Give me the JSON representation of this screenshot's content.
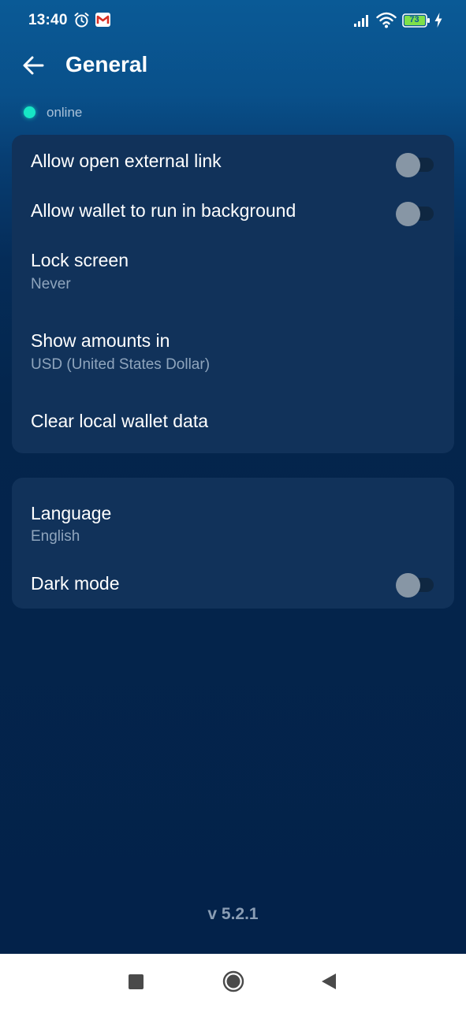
{
  "status_bar": {
    "time": "13:40",
    "battery": "73",
    "icons": [
      "alarm-icon",
      "gmail-icon",
      "signal-icon",
      "wifi-icon",
      "battery-icon",
      "charging-icon"
    ]
  },
  "header": {
    "title": "General",
    "back_icon": "arrow-left-icon"
  },
  "connection": {
    "status": "online",
    "color": "#17e6c5"
  },
  "settings_group_1": {
    "external_link": {
      "label": "Allow open external link",
      "enabled": false
    },
    "background": {
      "label": "Allow wallet to run in background",
      "enabled": false
    },
    "lock_screen": {
      "label": "Lock screen",
      "value": "Never"
    },
    "amounts": {
      "label": "Show amounts in",
      "value": "USD (United States Dollar)"
    },
    "clear_data": {
      "label": "Clear local wallet data"
    }
  },
  "settings_group_2": {
    "language": {
      "label": "Language",
      "value": "English"
    },
    "dark_mode": {
      "label": "Dark mode",
      "enabled": false
    }
  },
  "footer": {
    "version": "v 5.2.1"
  },
  "nav_bar": {
    "icons": [
      "recents-icon",
      "home-icon",
      "back-icon"
    ]
  },
  "colors": {
    "background": "#04244a",
    "card": "#11325a",
    "accent_online": "#17e6c5",
    "secondary_text": "#8fa5bd"
  }
}
